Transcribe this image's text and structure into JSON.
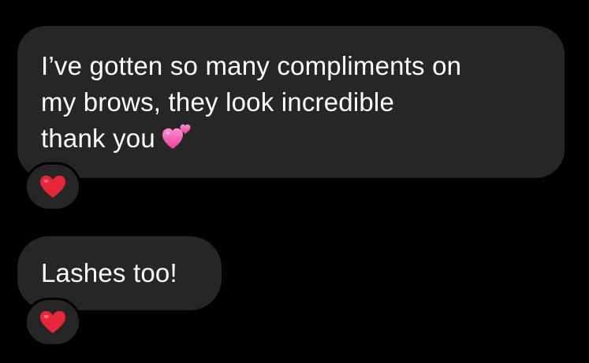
{
  "thread": {
    "messages": [
      {
        "lines": [
          "I’ve gotten so many compliments on",
          "my brows, they look incredible",
          "thank you"
        ],
        "trailing_emoji": "two-hearts-icon",
        "reaction": "red-heart-icon"
      },
      {
        "lines": [
          "Lashes too!"
        ],
        "reaction": "red-heart-icon"
      }
    ]
  },
  "colors": {
    "background": "#000000",
    "bubble": "#262626",
    "text": "#ffffff",
    "heart_red": "#e8263a",
    "heart_pink": "#f25bb0"
  }
}
